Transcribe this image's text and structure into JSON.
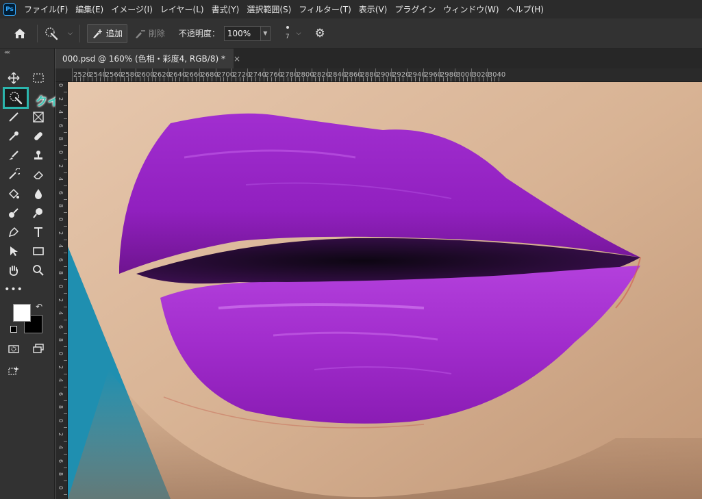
{
  "app": {
    "logo": "Ps"
  },
  "menu": [
    "ファイル(F)",
    "編集(E)",
    "イメージ(I)",
    "レイヤー(L)",
    "書式(Y)",
    "選択範囲(S)",
    "フィルター(T)",
    "表示(V)",
    "プラグイン",
    "ウィンドウ(W)",
    "ヘルプ(H)"
  ],
  "options": {
    "add_label": "追加",
    "remove_label": "削除",
    "opacity_label": "不透明度：",
    "opacity_value": "100%",
    "brush_size": "7"
  },
  "tab": {
    "title": "000.psd @ 160% (色相・彩度4, RGB/8) *",
    "close": "×"
  },
  "ruler": {
    "h_labels": [
      "2520",
      "2540",
      "2560",
      "2580",
      "2600",
      "2620",
      "2640",
      "2660",
      "2680",
      "2700",
      "2720",
      "2740",
      "2760",
      "2780",
      "2800",
      "2820",
      "2840",
      "2860",
      "2880",
      "2900",
      "2920",
      "2940",
      "2960",
      "2980",
      "3000",
      "3020",
      "3040"
    ],
    "v_labels": [
      "0",
      "2",
      "4",
      "6",
      "8",
      "0",
      "2",
      "4",
      "6",
      "8",
      "0",
      "2",
      "4",
      "6",
      "8",
      "0",
      "2",
      "4",
      "6",
      "8",
      "0",
      "2",
      "4",
      "6",
      "8",
      "0",
      "2",
      "4",
      "6",
      "8",
      "0"
    ]
  },
  "annotation": {
    "quick_select_label": "クイック選択ツール"
  },
  "colors": {
    "foreground": "#ffffff",
    "background": "#000000",
    "highlight": "#2bb5ad",
    "lip": "#9a1dbf",
    "skin": "#d9b598",
    "backdrop": "#1f8fb0"
  },
  "canvas": {
    "subject": "purple lips close-up"
  }
}
